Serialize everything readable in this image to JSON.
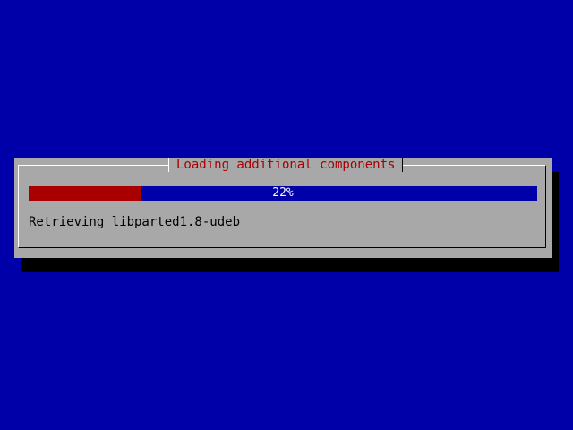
{
  "dialog": {
    "title": "Loading additional components",
    "progress": {
      "percent_text": "22%",
      "fraction": 0.22
    },
    "status_text": "Retrieving libparted1.8-udeb"
  },
  "colors": {
    "background": "#0000a8",
    "dialog_bg": "#a8a8a8",
    "title": "#a80000",
    "progress_fill": "#a80000",
    "progress_track": "#0000a8",
    "progress_text": "#ffffff"
  }
}
